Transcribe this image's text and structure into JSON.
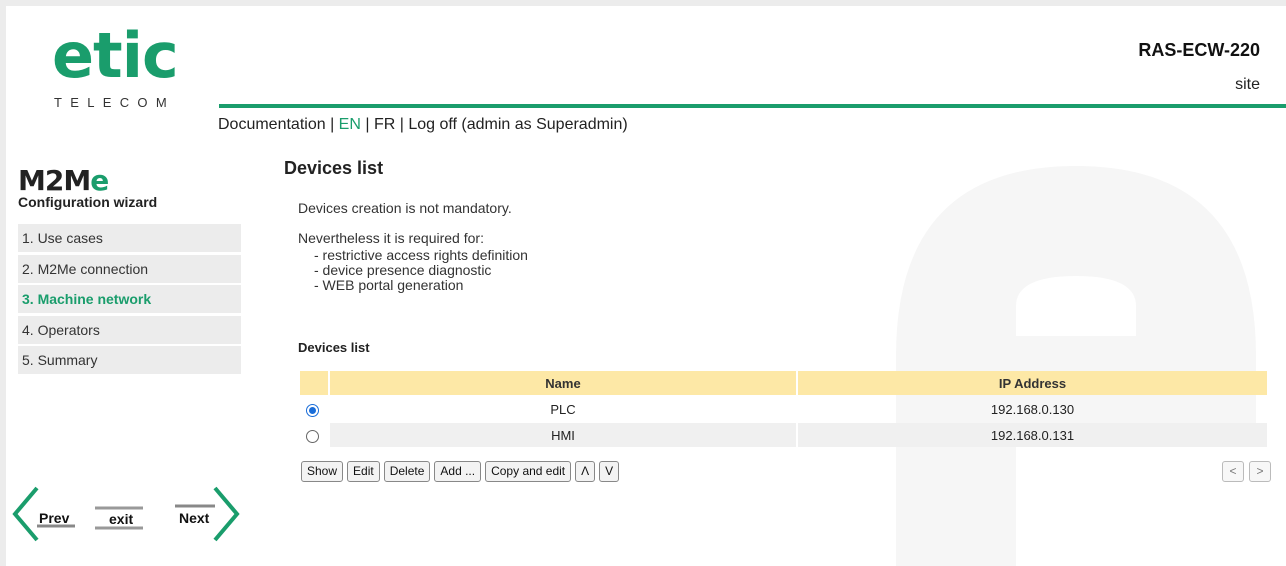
{
  "header": {
    "logo_text": "etic",
    "logo_sub": "TELECOM",
    "product": "RAS-ECW-220",
    "site": "site",
    "brand_color": "#1a9d6c"
  },
  "topnav": {
    "documentation": "Documentation",
    "sep1": " | ",
    "en": "EN",
    "sep2": " | ",
    "fr": "FR",
    "sep3": " | ",
    "logoff": "Log off (admin as Superadmin)"
  },
  "sidebar": {
    "wizard_logo": "M2Me",
    "wizard_title": "Configuration wizard",
    "steps": [
      {
        "label": "1. Use cases"
      },
      {
        "label": "2. M2Me connection"
      },
      {
        "label": "3. Machine network",
        "current": true
      },
      {
        "label": "4. Operators"
      },
      {
        "label": "5. Summary"
      }
    ],
    "nav": {
      "prev": "Prev",
      "exit": "exit",
      "next": "Next"
    }
  },
  "main": {
    "title": "Devices list",
    "intro1": "Devices creation is not mandatory.",
    "intro2": "Nevertheless it is required for:",
    "bullets": [
      "- restrictive access rights definition",
      "- device presence diagnostic",
      "- WEB portal generation"
    ],
    "table_title": "Devices list",
    "columns": {
      "name": "Name",
      "ip": "IP Address"
    },
    "rows": [
      {
        "name": "PLC",
        "ip": "192.168.0.130",
        "selected": true
      },
      {
        "name": "HMI",
        "ip": "192.168.0.131",
        "selected": false
      }
    ],
    "buttons": {
      "show": "Show",
      "edit": "Edit",
      "delete": "Delete",
      "add": "Add ...",
      "copy_edit": "Copy and edit",
      "up": "Λ",
      "down": "V"
    },
    "pager": {
      "prev": "<",
      "next": ">"
    }
  }
}
